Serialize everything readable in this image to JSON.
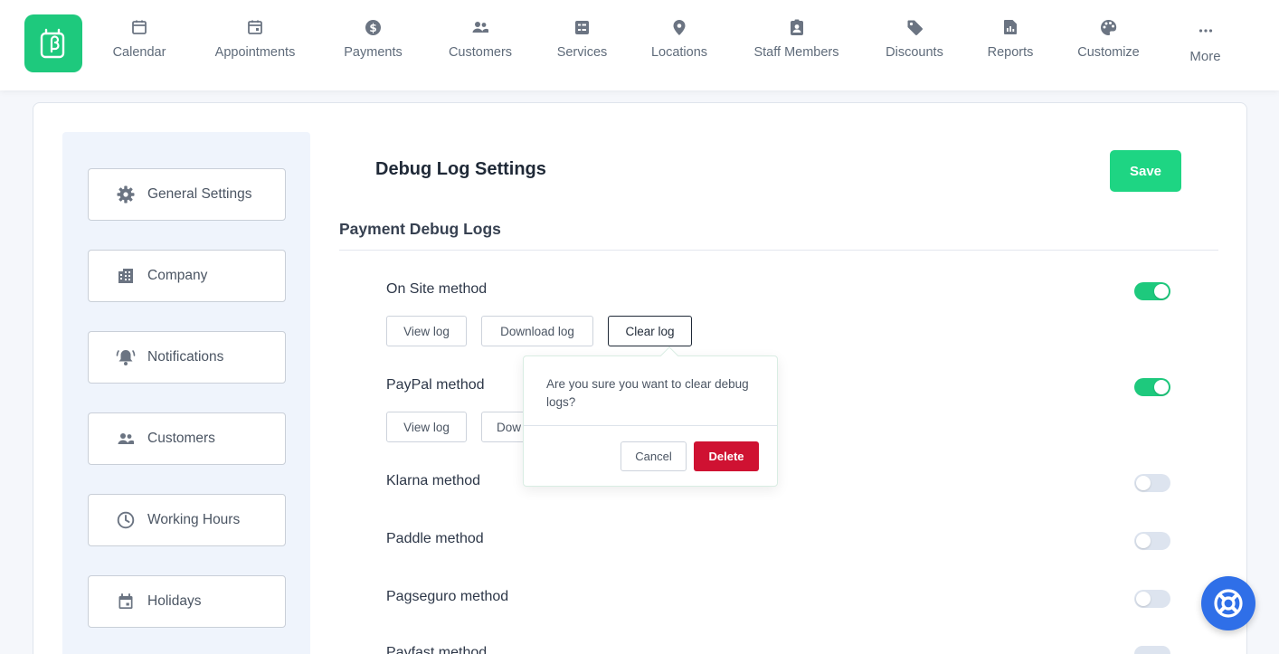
{
  "nav": {
    "logo_icon": "booking-logo-icon",
    "items": [
      {
        "label": "Calendar",
        "icon": "calendar-icon"
      },
      {
        "label": "Appointments",
        "icon": "calendar-check-icon"
      },
      {
        "label": "Payments",
        "icon": "dollar-circle-icon"
      },
      {
        "label": "Customers",
        "icon": "users-icon"
      },
      {
        "label": "Services",
        "icon": "list-box-icon"
      },
      {
        "label": "Locations",
        "icon": "map-pin-icon"
      },
      {
        "label": "Staff Members",
        "icon": "id-badge-icon"
      },
      {
        "label": "Discounts",
        "icon": "tag-icon"
      },
      {
        "label": "Reports",
        "icon": "report-icon"
      },
      {
        "label": "Customize",
        "icon": "palette-icon"
      },
      {
        "label": "More",
        "icon": "ellipsis-icon"
      }
    ]
  },
  "sidebar": {
    "items": [
      {
        "label": "General Settings",
        "icon": "gear-icon"
      },
      {
        "label": "Company",
        "icon": "building-icon"
      },
      {
        "label": "Notifications",
        "icon": "bell-icon"
      },
      {
        "label": "Customers",
        "icon": "users-icon"
      },
      {
        "label": "Working Hours",
        "icon": "clock-icon"
      },
      {
        "label": "Holidays",
        "icon": "calendar-icon"
      }
    ]
  },
  "main": {
    "title": "Debug Log Settings",
    "save_label": "Save",
    "section_title": "Payment Debug Logs",
    "view_log_label": "View log",
    "download_log_label": "Download log",
    "clear_log_label": "Clear log",
    "methods": [
      {
        "label": "On Site method",
        "enabled": true
      },
      {
        "label": "PayPal method",
        "enabled": true
      },
      {
        "label": "Klarna method",
        "enabled": false
      },
      {
        "label": "Paddle method",
        "enabled": false
      },
      {
        "label": "Pagseguro method",
        "enabled": false
      },
      {
        "label": "Payfast method",
        "enabled": false
      }
    ],
    "paypal_download_partial": "Dow"
  },
  "popover": {
    "message": "Are you sure you want to clear debug logs?",
    "cancel_label": "Cancel",
    "delete_label": "Delete"
  },
  "help": {
    "icon": "lifebuoy-icon"
  },
  "colors": {
    "accent": "#1ec97d",
    "danger": "#cf1232",
    "help": "#2f6fe8"
  }
}
